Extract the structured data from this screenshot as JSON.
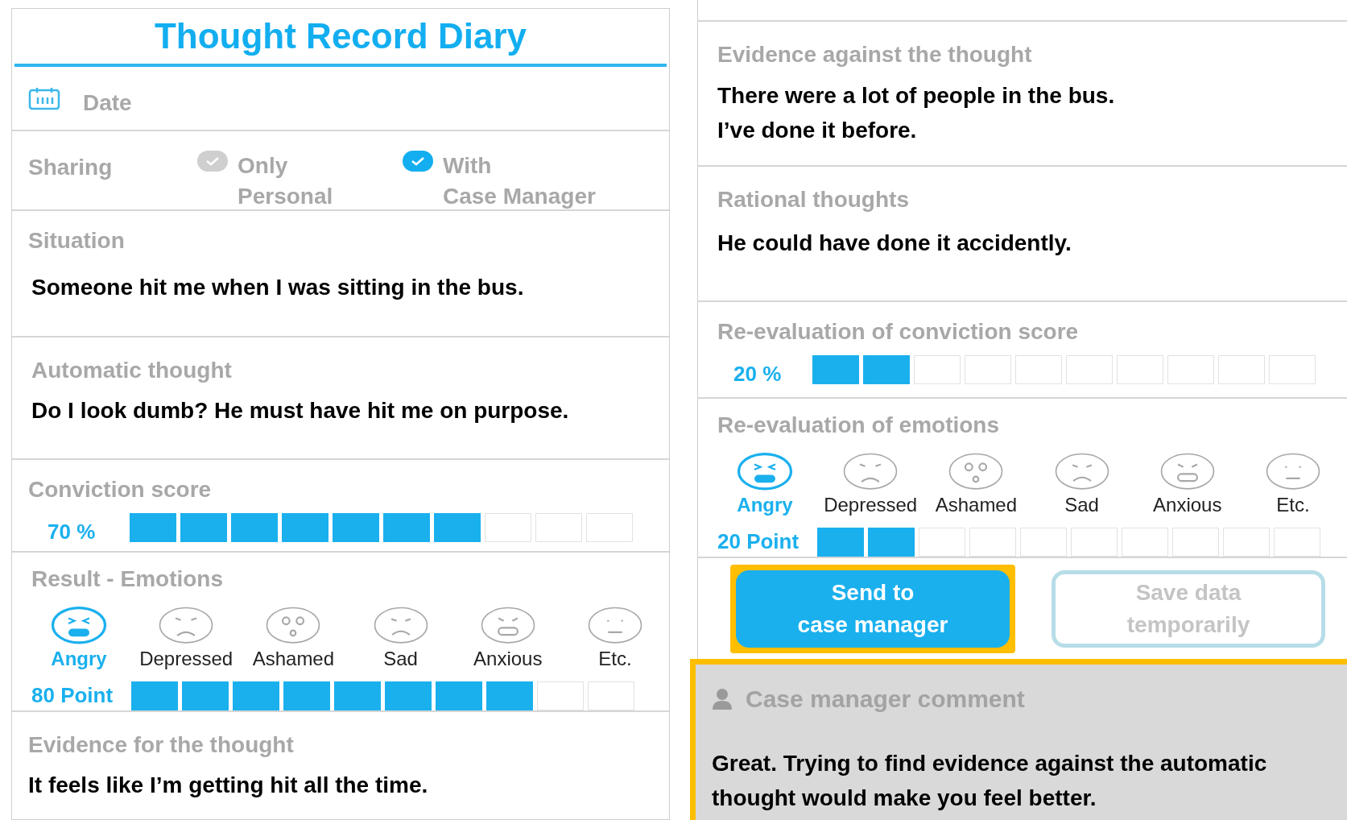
{
  "left": {
    "title": "Thought Record Diary",
    "date_label": "Date",
    "sharing": {
      "label": "Sharing",
      "options": [
        {
          "lines": [
            "Only",
            "Personal"
          ],
          "selected": false
        },
        {
          "lines": [
            "With",
            "Case Manager"
          ],
          "selected": true
        }
      ]
    },
    "situation": {
      "label": "Situation",
      "text": "Someone hit me when I was sitting in the bus."
    },
    "automatic_thought": {
      "label": "Automatic thought",
      "text": "Do I look dumb? He must have hit me on purpose."
    },
    "conviction": {
      "label": "Conviction score",
      "reading": "70 %",
      "level": 0.7
    },
    "emotions": {
      "label": "Result - Emotions",
      "items": [
        {
          "kind": "angry",
          "label": "Angry",
          "selected": true
        },
        {
          "kind": "depressed",
          "label": "Depressed",
          "selected": false
        },
        {
          "kind": "ashamed",
          "label": "Ashamed",
          "selected": false
        },
        {
          "kind": "sad",
          "label": "Sad",
          "selected": false
        },
        {
          "kind": "anxious",
          "label": "Anxious",
          "selected": false
        },
        {
          "kind": "neutral",
          "label": "Etc.",
          "selected": false
        }
      ],
      "reading": "80 Point",
      "level": 0.8
    },
    "evidence_for": {
      "label": "Evidence for the thought",
      "text": "It feels like I’m getting hit all the time."
    }
  },
  "right": {
    "evidence_against": {
      "label": "Evidence against the thought",
      "lines": [
        "There were a lot of people in the bus.",
        "I’ve done it before."
      ]
    },
    "rational": {
      "label": "Rational thoughts",
      "text": "He could have done it accidently."
    },
    "conviction": {
      "label": "Re-evaluation of conviction score",
      "reading": "20 %",
      "level": 0.2
    },
    "emotions": {
      "label": "Re-evaluation of emotions",
      "items": [
        {
          "kind": "angry",
          "label": "Angry",
          "selected": true
        },
        {
          "kind": "depressed",
          "label": "Depressed",
          "selected": false
        },
        {
          "kind": "ashamed",
          "label": "Ashamed",
          "selected": false
        },
        {
          "kind": "sad",
          "label": "Sad",
          "selected": false
        },
        {
          "kind": "anxious",
          "label": "Anxious",
          "selected": false
        },
        {
          "kind": "neutral",
          "label": "Etc.",
          "selected": false
        }
      ],
      "reading": "20 Point",
      "level": 0.2
    },
    "buttons": [
      {
        "kind": "primary",
        "lines": [
          "Send to",
          "case manager"
        ],
        "highlighted": true
      },
      {
        "kind": "secondary",
        "lines": [
          "Save data",
          "temporarily"
        ],
        "highlighted": false
      }
    ],
    "comment": {
      "label": "Case manager comment",
      "text": "Great. Trying to find evidence against the automatic thought would make you feel better.",
      "highlighted": true
    }
  }
}
